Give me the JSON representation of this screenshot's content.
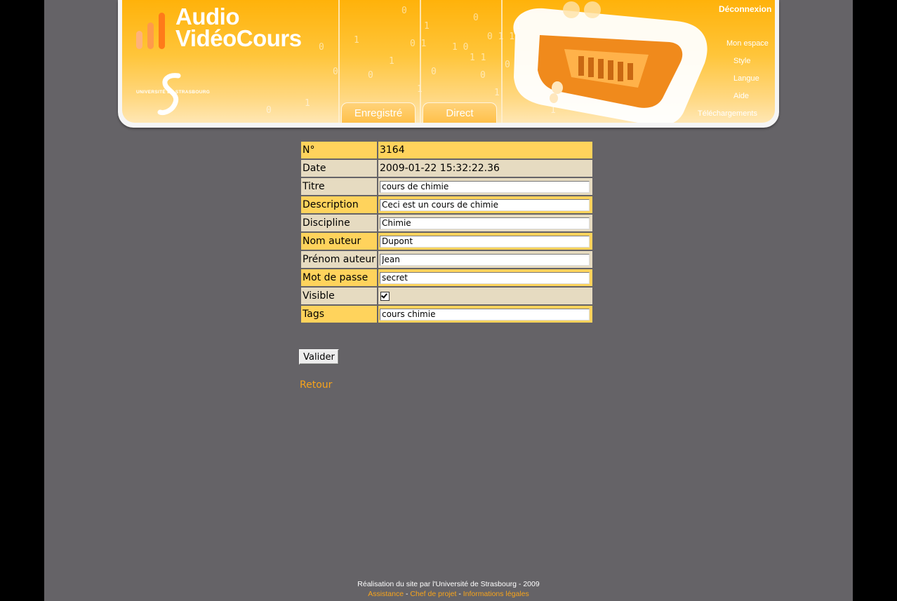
{
  "header": {
    "logo_line1": "Audio",
    "logo_line2": "VidéoCours",
    "university": "UNIVERSITÉ DE STRASBOURG",
    "tabs": [
      "Enregistré",
      "Direct"
    ],
    "logout": "Déconnexion",
    "menu": [
      "Mon espace",
      "Style",
      "Langue",
      "Aide",
      "Téléchargements"
    ]
  },
  "form": {
    "rows": [
      {
        "label": "N°",
        "value": "3164"
      },
      {
        "label": "Date",
        "value": "2009-01-22 15:32:22.36"
      },
      {
        "label": "Titre",
        "value": "cours de chimie"
      },
      {
        "label": "Description",
        "value": "Ceci est un cours de chimie"
      },
      {
        "label": "Discipline",
        "value": "Chimie"
      },
      {
        "label": "Nom auteur",
        "value": "Dupont"
      },
      {
        "label": "Prénom auteur",
        "value": "Jean"
      },
      {
        "label": "Mot de passe",
        "value": "secret"
      },
      {
        "label": "Visible",
        "checked": true
      },
      {
        "label": "Tags",
        "value": "cours chimie"
      }
    ],
    "submit_label": "Valider",
    "back_label": "Retour"
  },
  "footer": {
    "credit": "Réalisation du site par l'Université de Strasbourg - 2009",
    "links": [
      "Assistance",
      "Chef de projet",
      "Informations légales"
    ],
    "separator": "-"
  },
  "colors": {
    "page_bg": "#656367",
    "accent": "#f8a41b",
    "row_yellow": "#ffd35c",
    "row_beige": "#e6dbc1"
  }
}
